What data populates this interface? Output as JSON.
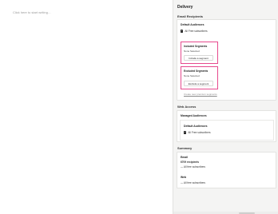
{
  "editor": {
    "placeholder": "Click here to start writing…"
  },
  "panel": {
    "title": "Delivery",
    "email_recipients": {
      "title": "Email Recipients",
      "default_audiences": {
        "title": "Default Audiences",
        "checkbox_label": "All Free subscribers",
        "checked": true
      },
      "included_segments": {
        "title": "Included Segments",
        "value": "None Selected",
        "button": "Include a segment"
      },
      "excluded_segments": {
        "title": "Excluded Segments",
        "value": "None Selected",
        "button": "Exclude a segment"
      },
      "link": "Create new premium segments"
    },
    "web_access": {
      "title": "Web Access",
      "managed_audiences": {
        "title": "Managed Audiences",
        "default_audiences_title": "Default Audiences",
        "checkbox_label": "All Free subscribers",
        "checked": true
      }
    },
    "summary": {
      "title": "Summary",
      "email": {
        "label": "Email",
        "count_text": "6709 recipients",
        "line": "— All free subscribers"
      },
      "web": {
        "label": "Web",
        "line": "— All free subscribers"
      }
    }
  },
  "colors": {
    "highlight": "#e64a8e",
    "panel_bg": "#f4f4f3"
  }
}
